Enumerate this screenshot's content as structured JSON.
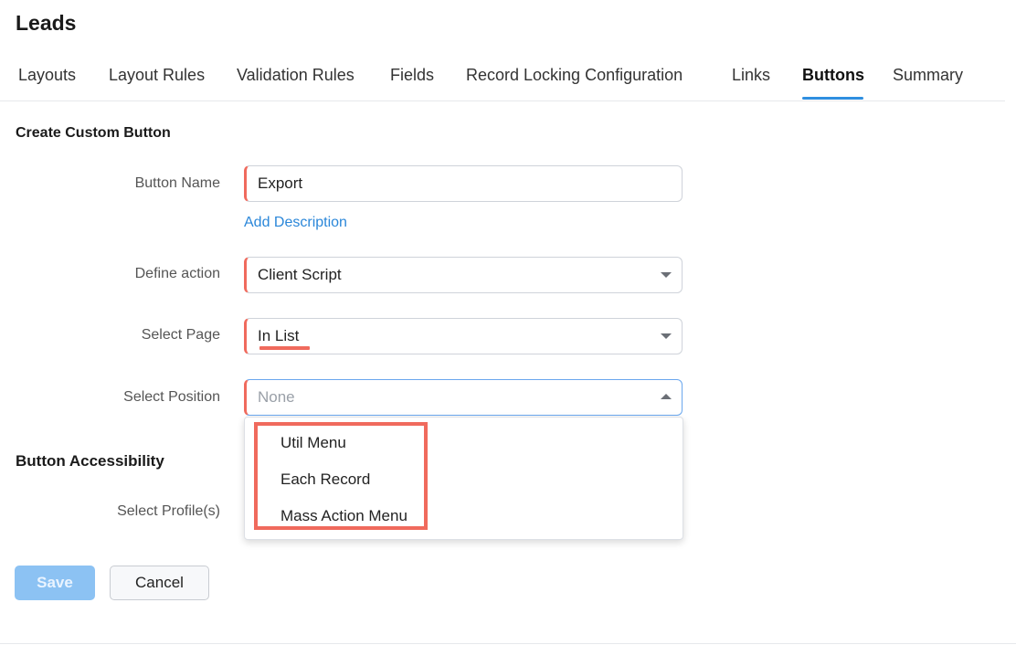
{
  "header": {
    "title": "Leads"
  },
  "tabs": [
    {
      "label": "Layouts"
    },
    {
      "label": "Layout Rules"
    },
    {
      "label": "Validation Rules"
    },
    {
      "label": "Fields"
    },
    {
      "label": "Record Locking Configuration"
    },
    {
      "label": "Links"
    },
    {
      "label": "Buttons",
      "active": true
    },
    {
      "label": "Summary"
    }
  ],
  "form": {
    "section_title": "Create Custom Button",
    "button_name": {
      "label": "Button Name",
      "value": "Export"
    },
    "add_description": "Add Description",
    "define_action": {
      "label": "Define action",
      "value": "Client Script"
    },
    "select_page": {
      "label": "Select Page",
      "value": "In List"
    },
    "select_position": {
      "label": "Select Position",
      "placeholder": "None",
      "options": [
        "Util Menu",
        "Each Record",
        "Mass Action Menu"
      ]
    },
    "accessibility_title": "Button Accessibility",
    "select_profiles": {
      "label": "Select Profile(s)"
    }
  },
  "actions": {
    "save": "Save",
    "cancel": "Cancel"
  },
  "colors": {
    "accent": "#2f8fe0",
    "required": "#f06a5d",
    "link": "#2b87d9",
    "save_disabled": "#8cc2f3"
  }
}
